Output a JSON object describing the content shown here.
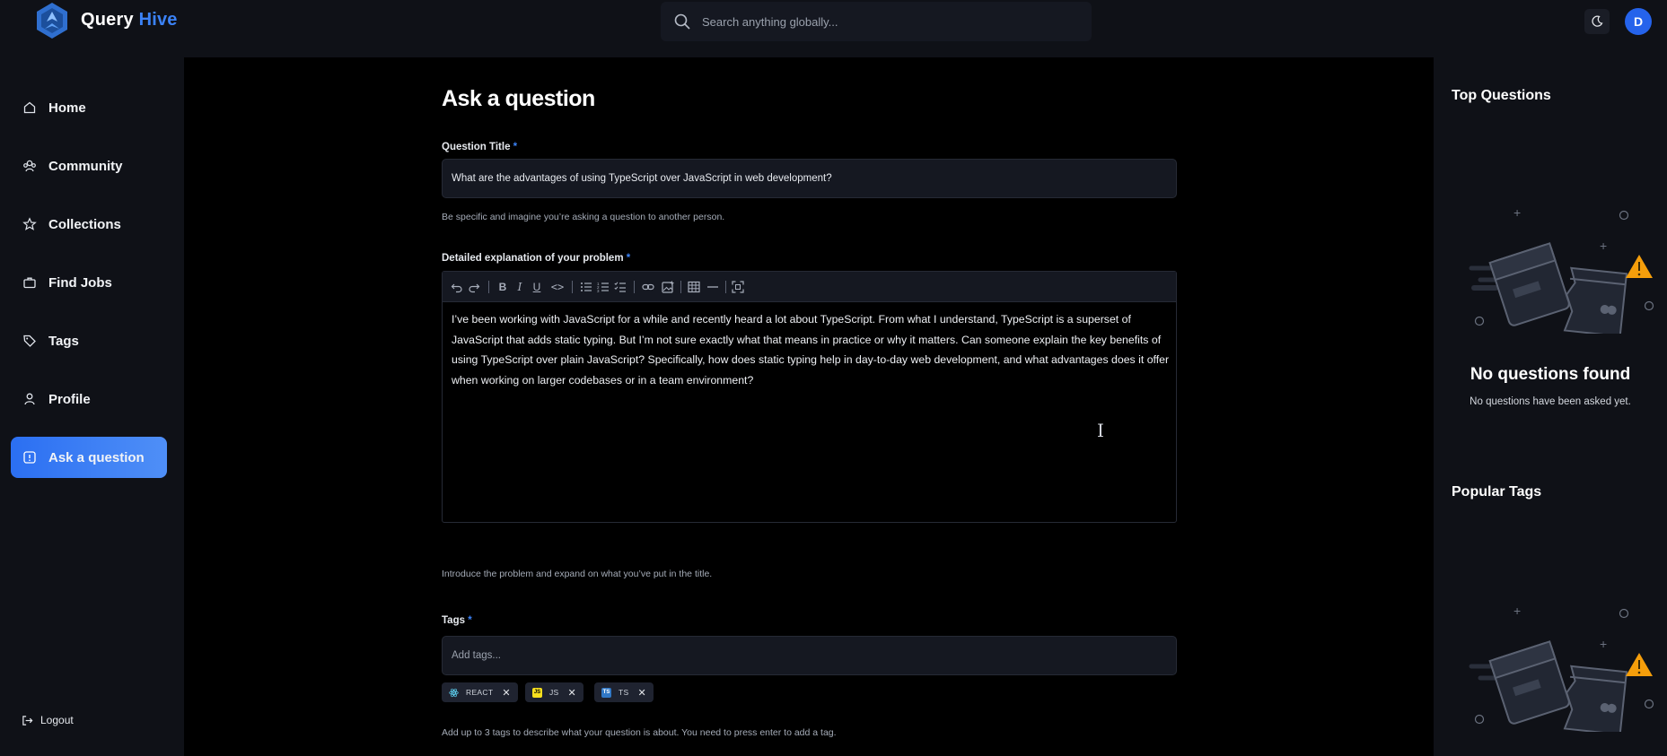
{
  "header": {
    "brand_part1": "Query",
    "brand_part2": "Hive",
    "search_placeholder": "Search anything globally...",
    "avatar_initial": "D"
  },
  "sidebar": {
    "items": [
      {
        "label": "Home",
        "icon": "home-icon"
      },
      {
        "label": "Community",
        "icon": "users-icon"
      },
      {
        "label": "Collections",
        "icon": "star-icon"
      },
      {
        "label": "Find Jobs",
        "icon": "briefcase-icon"
      },
      {
        "label": "Tags",
        "icon": "tag-icon"
      },
      {
        "label": "Profile",
        "icon": "user-icon"
      },
      {
        "label": "Ask a question",
        "icon": "question-icon",
        "active": true
      }
    ],
    "logout_label": "Logout"
  },
  "main": {
    "page_title": "Ask a question",
    "title_field": {
      "label": "Question Title",
      "required_mark": "*",
      "value": "What are the advantages of using TypeScript over JavaScript in web development?",
      "hint": "Be specific and imagine you’re asking a question to another person."
    },
    "explanation_field": {
      "label": "Detailed explanation of your problem",
      "required_mark": "*",
      "value": "I’ve been working with JavaScript for a while and recently heard a lot about TypeScript. From what I understand, TypeScript is a superset of JavaScript that adds static typing. But I’m not sure exactly what that means in practice or why it matters. Can someone explain the key benefits of using TypeScript over plain JavaScript? Specifically, how does static typing help in day-to-day web development, and what advantages does it offer when working on larger codebases or in a team environment?",
      "hint": "Introduce the problem and expand on what you’ve put in the title."
    },
    "tags_field": {
      "label": "Tags",
      "required_mark": "*",
      "placeholder": "Add tags...",
      "tags": [
        "REACT",
        "JS",
        "TS"
      ],
      "hint": "Add up to 3 tags to describe what your question is about. You need to press enter to add a tag."
    }
  },
  "rightbar": {
    "top_questions_title": "Top Questions",
    "empty_title": "No questions found",
    "empty_subtitle": "No questions have been asked yet.",
    "popular_tags_title": "Popular Tags"
  },
  "colors": {
    "accent": "#3b82f6",
    "panel": "#0f1117",
    "warning": "#f59e0b"
  }
}
